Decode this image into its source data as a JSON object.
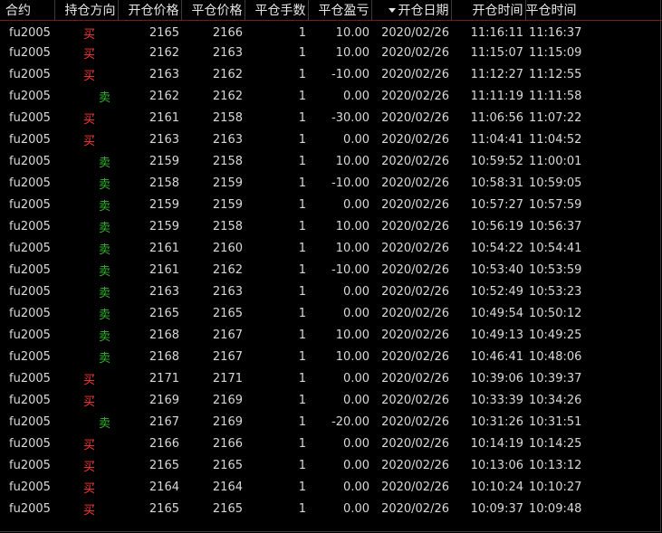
{
  "colors": {
    "background": "#000000",
    "text": "#d9d9d9",
    "buy": "#ff3b3b",
    "sell": "#2fb52f",
    "header_divider": "#7a1d1d"
  },
  "header": {
    "contract": "合约",
    "direction": "持仓方向",
    "open_price": "开仓价格",
    "close_price": "平仓价格",
    "lots": "平仓手数",
    "pnl": "平仓盈亏",
    "open_date": "开仓日期",
    "open_time": "开仓时间",
    "close_time": "平仓时间",
    "sort_icon": "triangle-down-icon"
  },
  "rows": [
    {
      "contract": "fu2005",
      "dir": "买",
      "side": "buy",
      "open": "2165",
      "close": "2166",
      "lots": "1",
      "pnl": "10.00",
      "date": "2020/02/26",
      "otime": "11:16:11",
      "ctime": "11:16:37"
    },
    {
      "contract": "fu2005",
      "dir": "买",
      "side": "buy",
      "open": "2162",
      "close": "2163",
      "lots": "1",
      "pnl": "10.00",
      "date": "2020/02/26",
      "otime": "11:15:07",
      "ctime": "11:15:09"
    },
    {
      "contract": "fu2005",
      "dir": "买",
      "side": "buy",
      "open": "2163",
      "close": "2162",
      "lots": "1",
      "pnl": "-10.00",
      "date": "2020/02/26",
      "otime": "11:12:27",
      "ctime": "11:12:55"
    },
    {
      "contract": "fu2005",
      "dir": "卖",
      "side": "sell",
      "open": "2162",
      "close": "2162",
      "lots": "1",
      "pnl": "0.00",
      "date": "2020/02/26",
      "otime": "11:11:19",
      "ctime": "11:11:58"
    },
    {
      "contract": "fu2005",
      "dir": "买",
      "side": "buy",
      "open": "2161",
      "close": "2158",
      "lots": "1",
      "pnl": "-30.00",
      "date": "2020/02/26",
      "otime": "11:06:56",
      "ctime": "11:07:22"
    },
    {
      "contract": "fu2005",
      "dir": "买",
      "side": "buy",
      "open": "2163",
      "close": "2163",
      "lots": "1",
      "pnl": "0.00",
      "date": "2020/02/26",
      "otime": "11:04:41",
      "ctime": "11:04:52"
    },
    {
      "contract": "fu2005",
      "dir": "卖",
      "side": "sell",
      "open": "2159",
      "close": "2158",
      "lots": "1",
      "pnl": "10.00",
      "date": "2020/02/26",
      "otime": "10:59:52",
      "ctime": "11:00:01"
    },
    {
      "contract": "fu2005",
      "dir": "卖",
      "side": "sell",
      "open": "2158",
      "close": "2159",
      "lots": "1",
      "pnl": "-10.00",
      "date": "2020/02/26",
      "otime": "10:58:31",
      "ctime": "10:59:05"
    },
    {
      "contract": "fu2005",
      "dir": "卖",
      "side": "sell",
      "open": "2159",
      "close": "2159",
      "lots": "1",
      "pnl": "0.00",
      "date": "2020/02/26",
      "otime": "10:57:27",
      "ctime": "10:57:59"
    },
    {
      "contract": "fu2005",
      "dir": "卖",
      "side": "sell",
      "open": "2159",
      "close": "2158",
      "lots": "1",
      "pnl": "10.00",
      "date": "2020/02/26",
      "otime": "10:56:19",
      "ctime": "10:56:37"
    },
    {
      "contract": "fu2005",
      "dir": "卖",
      "side": "sell",
      "open": "2161",
      "close": "2160",
      "lots": "1",
      "pnl": "10.00",
      "date": "2020/02/26",
      "otime": "10:54:22",
      "ctime": "10:54:41"
    },
    {
      "contract": "fu2005",
      "dir": "卖",
      "side": "sell",
      "open": "2161",
      "close": "2162",
      "lots": "1",
      "pnl": "-10.00",
      "date": "2020/02/26",
      "otime": "10:53:40",
      "ctime": "10:53:59"
    },
    {
      "contract": "fu2005",
      "dir": "卖",
      "side": "sell",
      "open": "2163",
      "close": "2163",
      "lots": "1",
      "pnl": "0.00",
      "date": "2020/02/26",
      "otime": "10:52:49",
      "ctime": "10:53:23"
    },
    {
      "contract": "fu2005",
      "dir": "卖",
      "side": "sell",
      "open": "2165",
      "close": "2165",
      "lots": "1",
      "pnl": "0.00",
      "date": "2020/02/26",
      "otime": "10:49:54",
      "ctime": "10:50:12"
    },
    {
      "contract": "fu2005",
      "dir": "卖",
      "side": "sell",
      "open": "2168",
      "close": "2167",
      "lots": "1",
      "pnl": "10.00",
      "date": "2020/02/26",
      "otime": "10:49:13",
      "ctime": "10:49:25"
    },
    {
      "contract": "fu2005",
      "dir": "卖",
      "side": "sell",
      "open": "2168",
      "close": "2167",
      "lots": "1",
      "pnl": "10.00",
      "date": "2020/02/26",
      "otime": "10:46:41",
      "ctime": "10:48:06"
    },
    {
      "contract": "fu2005",
      "dir": "买",
      "side": "buy",
      "open": "2171",
      "close": "2171",
      "lots": "1",
      "pnl": "0.00",
      "date": "2020/02/26",
      "otime": "10:39:06",
      "ctime": "10:39:37"
    },
    {
      "contract": "fu2005",
      "dir": "买",
      "side": "buy",
      "open": "2169",
      "close": "2169",
      "lots": "1",
      "pnl": "0.00",
      "date": "2020/02/26",
      "otime": "10:33:39",
      "ctime": "10:34:26"
    },
    {
      "contract": "fu2005",
      "dir": "卖",
      "side": "sell",
      "open": "2167",
      "close": "2169",
      "lots": "1",
      "pnl": "-20.00",
      "date": "2020/02/26",
      "otime": "10:31:26",
      "ctime": "10:31:51"
    },
    {
      "contract": "fu2005",
      "dir": "买",
      "side": "buy",
      "open": "2166",
      "close": "2166",
      "lots": "1",
      "pnl": "0.00",
      "date": "2020/02/26",
      "otime": "10:14:19",
      "ctime": "10:14:25"
    },
    {
      "contract": "fu2005",
      "dir": "买",
      "side": "buy",
      "open": "2165",
      "close": "2165",
      "lots": "1",
      "pnl": "0.00",
      "date": "2020/02/26",
      "otime": "10:13:06",
      "ctime": "10:13:12"
    },
    {
      "contract": "fu2005",
      "dir": "买",
      "side": "buy",
      "open": "2164",
      "close": "2164",
      "lots": "1",
      "pnl": "0.00",
      "date": "2020/02/26",
      "otime": "10:10:24",
      "ctime": "10:10:27"
    },
    {
      "contract": "fu2005",
      "dir": "买",
      "side": "buy",
      "open": "2165",
      "close": "2165",
      "lots": "1",
      "pnl": "0.00",
      "date": "2020/02/26",
      "otime": "10:09:37",
      "ctime": "10:09:48"
    }
  ]
}
